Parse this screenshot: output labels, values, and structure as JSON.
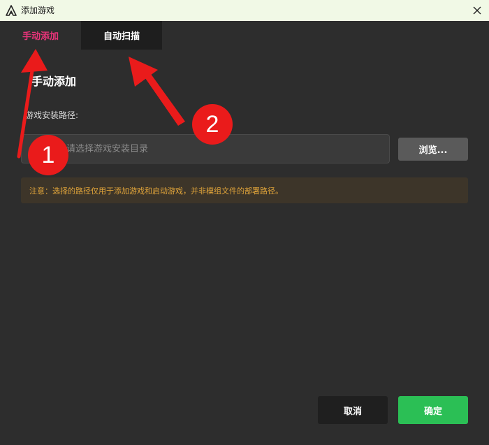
{
  "window": {
    "title": "添加游戏",
    "icons": {
      "app": "app-logo-icon",
      "close": "close-icon"
    }
  },
  "tabs": [
    {
      "label": "手动添加",
      "active": true
    },
    {
      "label": "自动扫描",
      "active": false
    }
  ],
  "manual": {
    "section_title": "手动添加",
    "path_label": "游戏安装路径:",
    "path_placeholder": "请选择游戏安装目录",
    "path_value": "",
    "browse_label": "浏览...",
    "notice": "注意：选择的路径仅用于添加游戏和启动游戏，并非模组文件的部署路径。"
  },
  "footer": {
    "cancel_label": "取消",
    "confirm_label": "确定"
  },
  "annotations": [
    {
      "number": "1"
    },
    {
      "number": "2"
    }
  ],
  "colors": {
    "background": "#2d2d2d",
    "titlebar": "#f1f9e6",
    "active_tab_text": "#e8347a",
    "tab_bg": "#1e1e1e",
    "notice_bg": "#3d3529",
    "notice_text": "#e0a43a",
    "confirm": "#2bbf55",
    "annotation_red": "#ea1b1b"
  }
}
